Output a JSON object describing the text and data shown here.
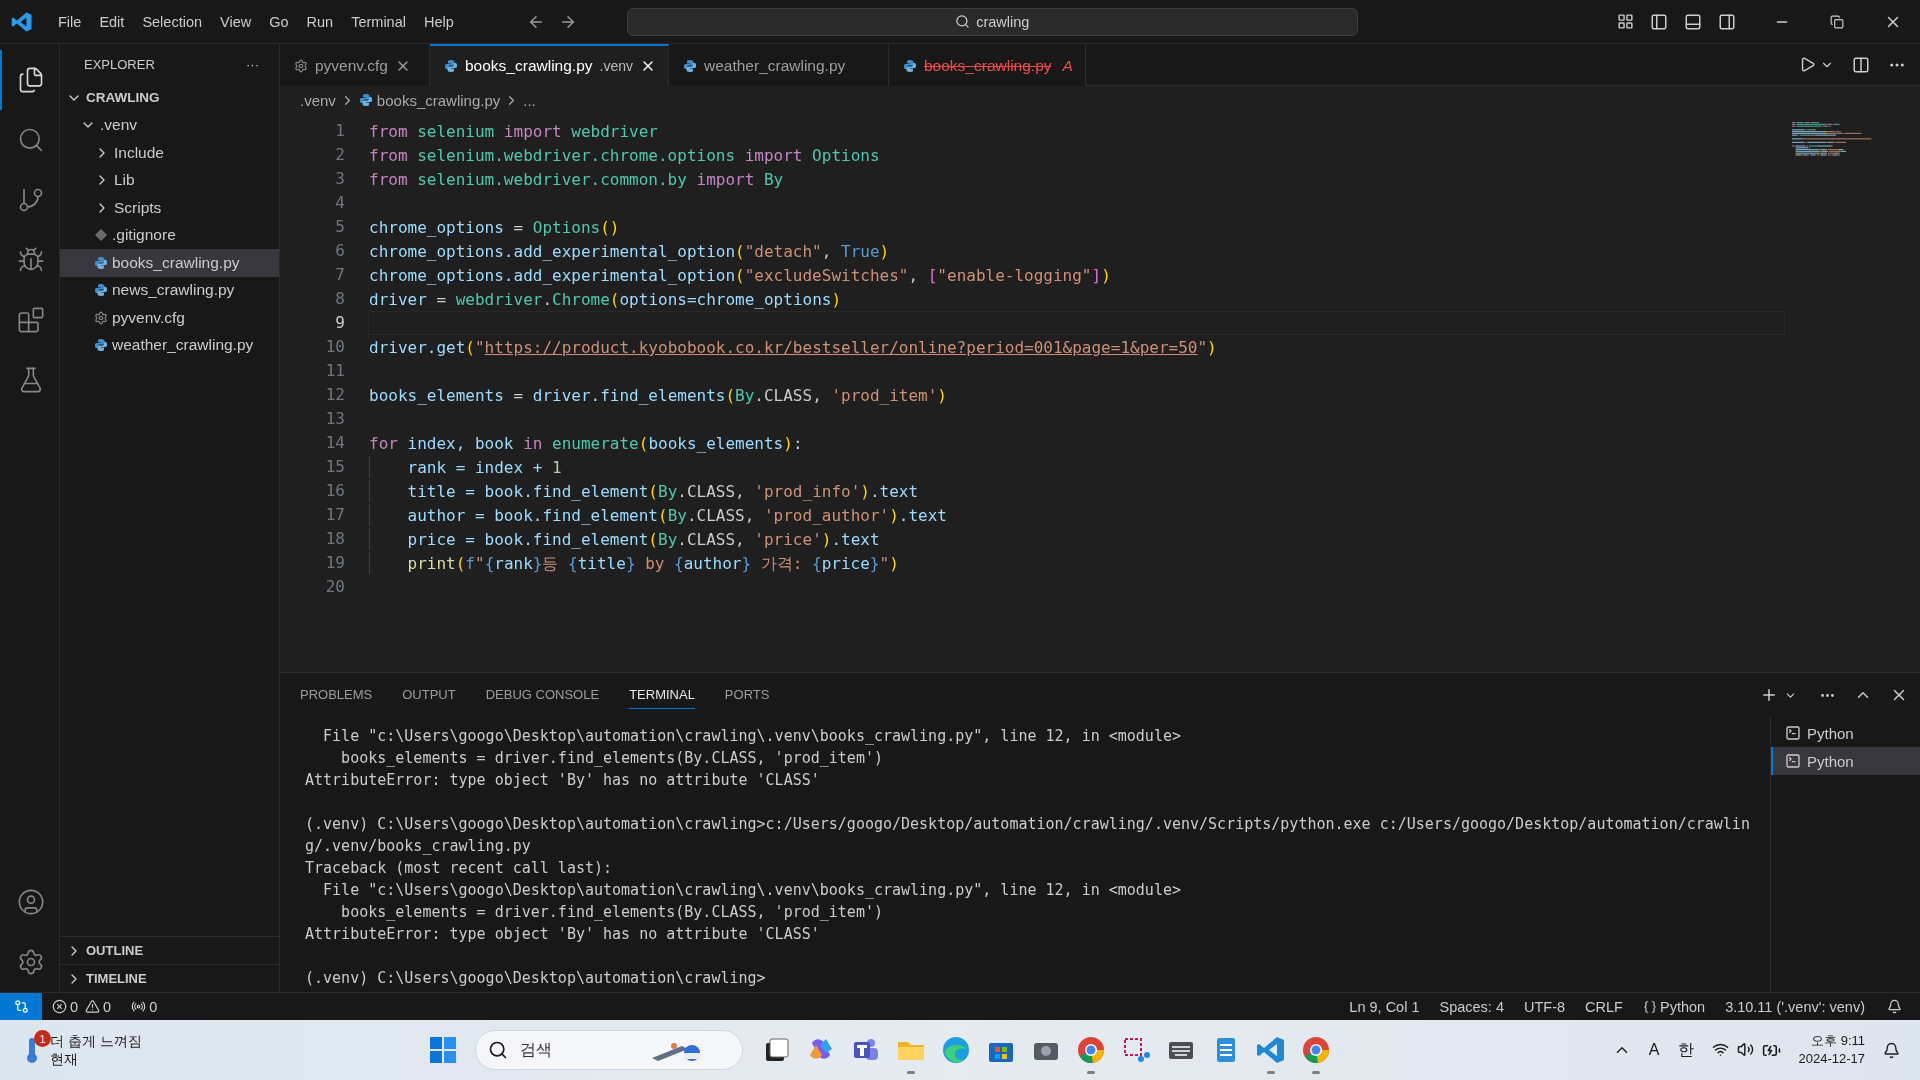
{
  "window": {
    "menu": [
      "File",
      "Edit",
      "Selection",
      "View",
      "Go",
      "Run",
      "Terminal",
      "Help"
    ],
    "search": {
      "value": "crawling"
    }
  },
  "activity_bar": {
    "items": [
      {
        "kind": "explorer",
        "selected": true
      },
      {
        "kind": "search",
        "selected": false
      },
      {
        "kind": "source-control",
        "selected": false
      },
      {
        "kind": "run",
        "selected": false
      },
      {
        "kind": "extensions",
        "selected": false
      },
      {
        "kind": "testing",
        "selected": false
      }
    ],
    "bottom": [
      {
        "kind": "account"
      },
      {
        "kind": "settings"
      }
    ]
  },
  "sidebar": {
    "title": "EXPLORER",
    "more": "···",
    "root": {
      "label": "CRAWLING",
      "expanded": true,
      "children": [
        {
          "label": ".venv",
          "kind": "folder",
          "expanded": true,
          "selected": false,
          "children": [
            {
              "label": "Include",
              "kind": "folder",
              "expanded": false,
              "selected": false
            },
            {
              "label": "Lib",
              "kind": "folder",
              "expanded": false,
              "selected": false
            },
            {
              "label": "Scripts",
              "kind": "folder",
              "expanded": false,
              "selected": false
            },
            {
              "label": ".gitignore",
              "kind": "git",
              "selected": false
            },
            {
              "label": "books_crawling.py",
              "kind": "python",
              "selected": true
            },
            {
              "label": "news_crawling.py",
              "kind": "python",
              "selected": false
            },
            {
              "label": "pyvenv.cfg",
              "kind": "config",
              "selected": false
            },
            {
              "label": "weather_crawling.py",
              "kind": "python",
              "selected": false
            }
          ]
        }
      ]
    },
    "sections": [
      {
        "label": "OUTLINE",
        "expanded": false
      },
      {
        "label": "TIMELINE",
        "expanded": false
      }
    ]
  },
  "tabs": [
    {
      "label": "pyvenv.cfg",
      "kind": "config",
      "selected": false,
      "deleted": false,
      "closable": true
    },
    {
      "label": "books_crawling.py",
      "description": ".venv",
      "kind": "python",
      "selected": true,
      "deleted": false,
      "closable": true
    },
    {
      "label": "weather_crawling.py",
      "kind": "python",
      "selected": false,
      "deleted": false,
      "closable": false
    },
    {
      "label": "books_crawling.py",
      "kind": "python",
      "selected": false,
      "deleted": true,
      "closable": false,
      "status": "A"
    }
  ],
  "breadcrumb": [
    ".venv",
    "books_crawling.py",
    "..."
  ],
  "editor": {
    "lines": [
      {
        "number": "1",
        "selected": false,
        "tokens": [
          {
            "text": "from",
            "kind": "kw"
          },
          {
            "text": " selenium ",
            "kind": "mod"
          },
          {
            "text": "import",
            "kind": "kw"
          },
          {
            "text": " webdriver",
            "kind": "mod"
          }
        ]
      },
      {
        "number": "2",
        "selected": false,
        "tokens": [
          {
            "text": "from",
            "kind": "kw"
          },
          {
            "text": " selenium.webdriver.chrome.options ",
            "kind": "mod"
          },
          {
            "text": "import",
            "kind": "kw"
          },
          {
            "text": " Options",
            "kind": "mod"
          }
        ]
      },
      {
        "number": "3",
        "selected": false,
        "tokens": [
          {
            "text": "from",
            "kind": "kw"
          },
          {
            "text": " selenium.webdriver.common.by ",
            "kind": "mod"
          },
          {
            "text": "import",
            "kind": "kw"
          },
          {
            "text": " By",
            "kind": "mod"
          }
        ]
      },
      {
        "number": "4",
        "selected": false
      },
      {
        "number": "5",
        "selected": false,
        "tokens": [
          {
            "text": "chrome_options",
            "kind": "var"
          },
          {
            "text": " = ",
            "kind": "op"
          },
          {
            "text": "Options",
            "kind": "mod"
          },
          {
            "text": "()",
            "kind": "br1"
          }
        ]
      },
      {
        "number": "6",
        "selected": false,
        "tokens": [
          {
            "text": "chrome_options.add_experimental_option",
            "kind": "var"
          },
          {
            "text": "(",
            "kind": "br1"
          },
          {
            "text": "\"detach\"",
            "kind": "str"
          },
          {
            "text": ", ",
            "kind": "op"
          },
          {
            "text": "True",
            "kind": "const"
          },
          {
            "text": ")",
            "kind": "br1"
          }
        ]
      },
      {
        "number": "7",
        "selected": false,
        "tokens": [
          {
            "text": "chrome_options.add_experimental_option",
            "kind": "var"
          },
          {
            "text": "(",
            "kind": "br1"
          },
          {
            "text": "\"excludeSwitches\"",
            "kind": "str"
          },
          {
            "text": ", ",
            "kind": "op"
          },
          {
            "text": "[",
            "kind": "br2"
          },
          {
            "text": "\"enable-logging\"",
            "kind": "str"
          },
          {
            "text": "]",
            "kind": "br2"
          },
          {
            "text": ")",
            "kind": "br1"
          }
        ]
      },
      {
        "number": "8",
        "selected": false,
        "tokens": [
          {
            "text": "driver",
            "kind": "var"
          },
          {
            "text": " = ",
            "kind": "op"
          },
          {
            "text": "webdriver",
            "kind": "mod"
          },
          {
            "text": ".",
            "kind": "op"
          },
          {
            "text": "Chrome",
            "kind": "mod"
          },
          {
            "text": "(",
            "kind": "br1"
          },
          {
            "text": "options=chrome_options",
            "kind": "var"
          },
          {
            "text": ")",
            "kind": "br1"
          }
        ]
      },
      {
        "number": "9",
        "selected": true
      },
      {
        "number": "10",
        "selected": false,
        "tokens": [
          {
            "text": "driver.get",
            "kind": "var"
          },
          {
            "text": "(",
            "kind": "br1"
          },
          {
            "text": "\"",
            "kind": "str"
          },
          {
            "text": "https://product.kyobobook.co.kr/bestseller/online?period=001&page=1&per=50",
            "kind": "link"
          },
          {
            "text": "\"",
            "kind": "str"
          },
          {
            "text": ")",
            "kind": "br1"
          }
        ]
      },
      {
        "number": "11",
        "selected": false
      },
      {
        "number": "12",
        "selected": false,
        "tokens": [
          {
            "text": "books_elements",
            "kind": "var"
          },
          {
            "text": " = ",
            "kind": "op"
          },
          {
            "text": "driver.find_elements",
            "kind": "var"
          },
          {
            "text": "(",
            "kind": "br1"
          },
          {
            "text": "By",
            "kind": "mod"
          },
          {
            "text": ".CLASS, ",
            "kind": "op"
          },
          {
            "text": "'prod_item'",
            "kind": "str"
          },
          {
            "text": ")",
            "kind": "br1"
          }
        ]
      },
      {
        "number": "13",
        "selected": false
      },
      {
        "number": "14",
        "selected": false,
        "tokens": [
          {
            "text": "for",
            "kind": "kw"
          },
          {
            "text": " index, book ",
            "kind": "var"
          },
          {
            "text": "in",
            "kind": "kw"
          },
          {
            "text": " enumerate",
            "kind": "mod"
          },
          {
            "text": "(",
            "kind": "br1"
          },
          {
            "text": "books_elements",
            "kind": "var"
          },
          {
            "text": ")",
            "kind": "br1"
          },
          {
            "text": ":",
            "kind": "op"
          }
        ]
      },
      {
        "number": "15",
        "selected": false,
        "tokens": [
          {
            "text": "    rank = index + ",
            "kind": "var"
          },
          {
            "text": "1",
            "kind": "num"
          }
        ]
      },
      {
        "number": "16",
        "selected": false,
        "tokens": [
          {
            "text": "    title = book.find_element",
            "kind": "var"
          },
          {
            "text": "(",
            "kind": "br1"
          },
          {
            "text": "By",
            "kind": "mod"
          },
          {
            "text": ".CLASS, ",
            "kind": "op"
          },
          {
            "text": "'prod_info'",
            "kind": "str"
          },
          {
            "text": ")",
            "kind": "br1"
          },
          {
            "text": ".text",
            "kind": "var"
          }
        ]
      },
      {
        "number": "17",
        "selected": false,
        "tokens": [
          {
            "text": "    author = book.find_element",
            "kind": "var"
          },
          {
            "text": "(",
            "kind": "br1"
          },
          {
            "text": "By",
            "kind": "mod"
          },
          {
            "text": ".CLASS, ",
            "kind": "op"
          },
          {
            "text": "'prod_author'",
            "kind": "str"
          },
          {
            "text": ")",
            "kind": "br1"
          },
          {
            "text": ".text",
            "kind": "var"
          }
        ]
      },
      {
        "number": "18",
        "selected": false,
        "tokens": [
          {
            "text": "    price = book.find_element",
            "kind": "var"
          },
          {
            "text": "(",
            "kind": "br1"
          },
          {
            "text": "By",
            "kind": "mod"
          },
          {
            "text": ".CLASS, ",
            "kind": "op"
          },
          {
            "text": "'price'",
            "kind": "str"
          },
          {
            "text": ")",
            "kind": "br1"
          },
          {
            "text": ".text",
            "kind": "var"
          }
        ]
      },
      {
        "number": "19",
        "selected": false,
        "tokens": [
          {
            "text": "    print",
            "kind": "fn"
          },
          {
            "text": "(",
            "kind": "br1"
          },
          {
            "text": "f",
            "kind": "const"
          },
          {
            "text": "\"",
            "kind": "str"
          },
          {
            "text": "{",
            "kind": "const"
          },
          {
            "text": "rank",
            "kind": "var"
          },
          {
            "text": "}",
            "kind": "const"
          },
          {
            "text": "등 ",
            "kind": "str"
          },
          {
            "text": "{",
            "kind": "const"
          },
          {
            "text": "title",
            "kind": "var"
          },
          {
            "text": "}",
            "kind": "const"
          },
          {
            "text": " by ",
            "kind": "str"
          },
          {
            "text": "{",
            "kind": "const"
          },
          {
            "text": "author",
            "kind": "var"
          },
          {
            "text": "}",
            "kind": "const"
          },
          {
            "text": " 가격: ",
            "kind": "str"
          },
          {
            "text": "{",
            "kind": "const"
          },
          {
            "text": "price",
            "kind": "var"
          },
          {
            "text": "}",
            "kind": "const"
          },
          {
            "text": "\"",
            "kind": "str"
          },
          {
            "text": ")",
            "kind": "br1"
          }
        ]
      },
      {
        "number": "20",
        "selected": false
      }
    ]
  },
  "panel": {
    "tabs": [
      {
        "label": "PROBLEMS",
        "selected": false
      },
      {
        "label": "OUTPUT",
        "selected": false
      },
      {
        "label": "DEBUG CONSOLE",
        "selected": false
      },
      {
        "label": "TERMINAL",
        "selected": true
      },
      {
        "label": "PORTS",
        "selected": false
      }
    ],
    "terminal_blocks": [
      [
        "  File \"c:\\Users\\googo\\Desktop\\automation\\crawling\\.venv\\books_crawling.py\", line 12, in <module>",
        "    books_elements = driver.find_elements(By.CLASS, 'prod_item')",
        "AttributeError: type object 'By' has no attribute 'CLASS'"
      ],
      [
        "(.venv) C:\\Users\\googo\\Desktop\\automation\\crawling>c:/Users/googo/Desktop/automation/crawling/.venv/Scripts/python.exe c:/Users/googo/Desktop/automation/crawlin",
        "g/.venv/books_crawling.py",
        "Traceback (most recent call last):",
        "  File \"c:\\Users\\googo\\Desktop\\automation\\crawling\\.venv\\books_crawling.py\", line 12, in <module>",
        "    books_elements = driver.find_elements(By.CLASS, 'prod_item')",
        "AttributeError: type object 'By' has no attribute 'CLASS'"
      ],
      [
        "(.venv) C:\\Users\\googo\\Desktop\\automation\\crawling>"
      ]
    ],
    "terminals": [
      {
        "label": "Python",
        "selected": false
      },
      {
        "label": "Python",
        "selected": true
      }
    ]
  },
  "status_bar": {
    "errors": "0",
    "warnings": "0",
    "ports": "0",
    "items": [
      {
        "text": "Ln 9, Col 1",
        "kind": "plain"
      },
      {
        "text": "Spaces: 4",
        "kind": "plain"
      },
      {
        "text": "UTF-8",
        "kind": "plain"
      },
      {
        "text": "CRLF",
        "kind": "plain"
      },
      {
        "text": "Python",
        "kind": "language"
      },
      {
        "text": "3.10.11 ('.venv': venv)",
        "kind": "plain"
      }
    ]
  },
  "taskbar": {
    "weather": {
      "badge": "1",
      "title": "더 춥게 느껴짐",
      "subtitle": "현재"
    },
    "search": {
      "placeholder": "검색"
    },
    "apps": [
      {
        "kind": "start",
        "running": false
      },
      {
        "kind": "task-view",
        "running": false
      },
      {
        "kind": "copilot",
        "running": false
      },
      {
        "kind": "teams",
        "running": false
      },
      {
        "kind": "files",
        "running": true
      },
      {
        "kind": "edge",
        "running": false
      },
      {
        "kind": "store",
        "running": false
      },
      {
        "kind": "camera",
        "running": false
      },
      {
        "kind": "chrome",
        "running": true
      },
      {
        "kind": "snip",
        "running": false
      },
      {
        "kind": "keyboard",
        "running": false
      },
      {
        "kind": "notepad",
        "running": false
      },
      {
        "kind": "vscode",
        "running": true
      },
      {
        "kind": "chrome",
        "running": true
      }
    ],
    "tray": {
      "ime_mode": "A",
      "ime_lang": "한",
      "time": "오후 9:11",
      "date": "2024-12-17"
    }
  }
}
